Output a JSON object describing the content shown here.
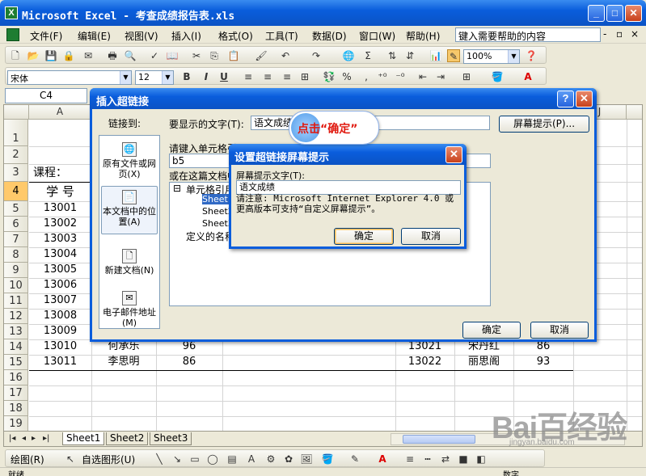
{
  "window": {
    "title": "Microsoft Excel - 考查成绩报告表.xls",
    "min": "_",
    "max": "□",
    "close": "✕"
  },
  "menu": {
    "items": [
      "文件(F)",
      "编辑(E)",
      "视图(V)",
      "插入(I)",
      "格式(O)",
      "工具(T)",
      "数据(D)",
      "窗口(W)",
      "帮助(H)"
    ],
    "help_placeholder": "键入需要帮助的内容",
    "ctrl_min": "-",
    "ctrl_restore": "▫",
    "ctrl_close": "×"
  },
  "toolbar": {
    "zoom": "100%",
    "font": "宋体",
    "size": "12",
    "bold": "B",
    "italic": "I",
    "underline": "U",
    "percent": "%",
    "comma": ",",
    "sigma": "Σ"
  },
  "formula": {
    "namebox": "C4"
  },
  "grid": {
    "columns": [
      "A",
      "J"
    ],
    "rows": [
      "1",
      "2",
      "3",
      "4",
      "5",
      "6",
      "7",
      "8",
      "9",
      "10",
      "11",
      "12",
      "13",
      "14",
      "15",
      "16",
      "17",
      "18",
      "19"
    ],
    "course_label": "课程：",
    "header_a": "学  号",
    "col_a": [
      "13001",
      "13002",
      "13003",
      "13004",
      "13005",
      "13006",
      "13007",
      "13008",
      "13009",
      "13010",
      "13011"
    ],
    "row14": {
      "b": "何承乐",
      "c": "96",
      "f": "13021",
      "g": "宋丹红",
      "h": "86"
    },
    "row15": {
      "b": "李思明",
      "c": "86",
      "f": "13022",
      "g": "丽思阁",
      "h": "93"
    }
  },
  "sheets": {
    "nav": [
      "|◂",
      "◂",
      "▸",
      "▸|"
    ],
    "tabs": [
      "Sheet1",
      "Sheet2",
      "Sheet3"
    ]
  },
  "drawbar": {
    "draw": "绘图(R)",
    "autoshape": "自选图形(U)"
  },
  "statusbar": {
    "ready": "就绪",
    "num": "数字"
  },
  "dialog": {
    "title": "插入超链接",
    "help": "?",
    "close": "✕",
    "link_to": "链接到:",
    "link_items": [
      "原有文件或网页(X)",
      "本文档中的位置(A)",
      "新建文档(N)",
      "电子邮件地址(M)"
    ],
    "display_text_label": "要显示的文字(T):",
    "display_text_value": "语文成绩",
    "screen_tip_button": "屏幕提示(P)...",
    "cell_ref_label": "请键入单元格引用(E):",
    "cell_ref_value": "b5",
    "place_label": "或在这篇文档中选择位置(C):",
    "tree_root": "单元格引用",
    "tree_items": [
      "Sheet1",
      "Sheet2",
      "Sheet3"
    ],
    "tree_defined": "定义的名称",
    "ok": "确定",
    "cancel": "取消"
  },
  "subdialog": {
    "title": "设置超链接屏幕提示",
    "close": "✕",
    "label": "屏幕提示文字(T):",
    "value": "语文成绩",
    "note": "请注意: Microsoft Internet Explorer 4.0 或更高版本可支持“自定义屏幕提示”。",
    "ok": "确定",
    "cancel": "取消"
  },
  "annotation": {
    "text": "点击“确定”"
  },
  "watermark": {
    "logo": "Bai百经验",
    "url": "jingyan.baidu.com"
  }
}
